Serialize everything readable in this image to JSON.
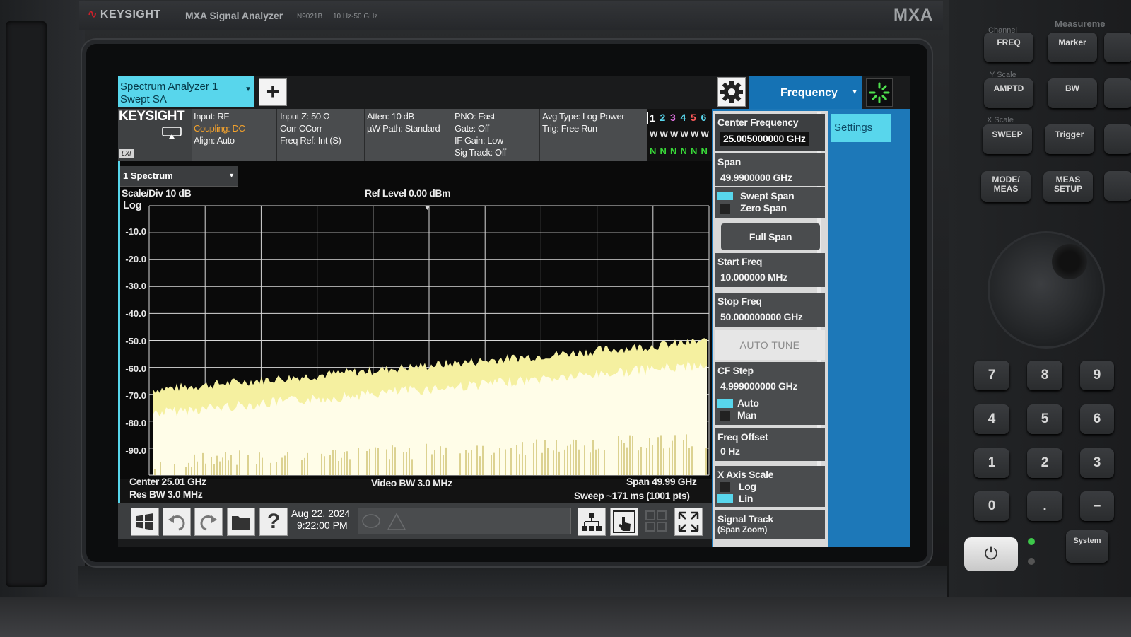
{
  "instrument": {
    "brand": "KEYSIGHT",
    "model_name": "MXA Signal Analyzer",
    "model_number": "N9021B",
    "freq_range": "10 Hz-50 GHz",
    "badge": "MXA"
  },
  "header": {
    "mode_tab_line1": "Spectrum Analyzer 1",
    "mode_tab_line2": "Swept SA",
    "add_symbol": "+",
    "menu_tab": "Frequency"
  },
  "info": {
    "logo": "KEYSIGHT",
    "lxi": "LXI",
    "col1": [
      "Input: RF",
      "Coupling: DC",
      "Align: Auto"
    ],
    "col2": [
      "Input Z: 50 Ω",
      "Corr CCorr",
      "Freq Ref: Int (S)"
    ],
    "col3": [
      "Atten: 10 dB",
      "µW Path: Standard"
    ],
    "col4": [
      "PNO: Fast",
      "Gate: Off",
      "IF Gain: Low",
      "Sig Track: Off"
    ],
    "col5": [
      "Avg Type: Log-Power",
      "Trig: Free Run"
    ],
    "trace_numbers": [
      "1",
      "2",
      "3",
      "4",
      "5",
      "6"
    ],
    "trace_colors": [
      "#ffffff",
      "#58d6ec",
      "#e070e0",
      "#58d6ec",
      "#ff5a5a",
      "#58d6ec"
    ],
    "trace_types": [
      "W",
      "W",
      "W",
      "W",
      "W",
      "W"
    ],
    "trace_detectors": [
      "N",
      "N",
      "N",
      "N",
      "N",
      "N"
    ]
  },
  "plot": {
    "window_select": "1 Spectrum",
    "scale_div": "Scale/Div 10 dB",
    "scale_type": "Log",
    "ref_level": "Ref Level 0.00 dBm",
    "y_ticks": [
      "-10.0",
      "-20.0",
      "-30.0",
      "-40.0",
      "-50.0",
      "-60.0",
      "-70.0",
      "-80.0",
      "-90.0"
    ],
    "center": "Center 25.01 GHz",
    "res_bw": "Res BW 3.0 MHz",
    "video_bw": "Video BW 3.0 MHz",
    "span": "Span 49.99 GHz",
    "sweep": "Sweep ~171 ms (1001 pts)",
    "trace_color": "#f5f0a0"
  },
  "taskbar": {
    "date": "Aug 22, 2024",
    "time": "9:22:00 PM",
    "help_symbol": "?"
  },
  "softkeys": {
    "settings_tab": "Settings",
    "center_freq_label": "Center Frequency",
    "center_freq_value": "25.005000000 GHz",
    "span_label": "Span",
    "span_value": "49.9900000 GHz",
    "swept_span": "Swept Span",
    "zero_span": "Zero Span",
    "full_span": "Full Span",
    "start_freq_label": "Start Freq",
    "start_freq_value": "10.000000 MHz",
    "stop_freq_label": "Stop Freq",
    "stop_freq_value": "50.000000000 GHz",
    "auto_tune": "AUTO TUNE",
    "cf_step_label": "CF Step",
    "cf_step_value": "4.999000000 GHz",
    "auto": "Auto",
    "man": "Man",
    "freq_offset_label": "Freq Offset",
    "freq_offset_value": "0 Hz",
    "x_axis_label": "X Axis Scale",
    "x_log": "Log",
    "x_lin": "Lin",
    "signal_track_label": "Signal Track",
    "signal_track_sub": "(Span Zoom)"
  },
  "front_panel": {
    "channel_group": "Channel",
    "measure_group": "Measureme",
    "yscale_group": "Y Scale",
    "xscale_group": "X Scale",
    "freq": "FREQ",
    "marker": "Marker",
    "amptd": "AMPTD",
    "bw": "BW",
    "sweep": "SWEEP",
    "trigger": "Trigger",
    "mode_meas_1": "MODE/",
    "mode_meas_2": "MEAS",
    "meas_setup_1": "MEAS",
    "meas_setup_2": "SETUP",
    "keys": [
      "7",
      "8",
      "9",
      "4",
      "5",
      "6",
      "1",
      "2",
      "3",
      "0",
      ".",
      "–"
    ],
    "power_symbol": "⏻",
    "system": "System"
  }
}
